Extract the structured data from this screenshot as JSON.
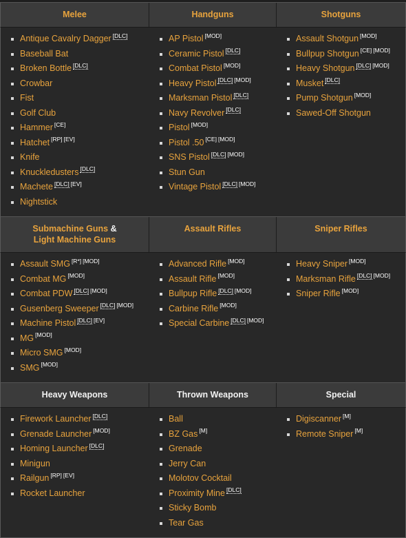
{
  "theme": {
    "page_background": "#1e1e1e",
    "table_background": "#282828",
    "header_background": "#3b3b3b",
    "link_color": "#e8a33d",
    "tag_color": "#ffffff",
    "border_color": "#5a5a5a"
  },
  "sections": [
    {
      "headers": [
        {
          "label": "Melee",
          "style": "gold"
        },
        {
          "label": "Handguns",
          "style": "gold"
        },
        {
          "label": "Shotguns",
          "style": "gold"
        }
      ],
      "columns": [
        [
          {
            "name": "Antique Cavalry Dagger",
            "tags": [
              "DLC"
            ]
          },
          {
            "name": "Baseball Bat",
            "tags": []
          },
          {
            "name": "Broken Bottle",
            "tags": [
              "DLC"
            ]
          },
          {
            "name": "Crowbar",
            "tags": []
          },
          {
            "name": "Fist",
            "tags": []
          },
          {
            "name": "Golf Club",
            "tags": []
          },
          {
            "name": "Hammer",
            "tags": [
              "CE"
            ]
          },
          {
            "name": "Hatchet",
            "tags": [
              "RP",
              "EV"
            ]
          },
          {
            "name": "Knife",
            "tags": []
          },
          {
            "name": "Knuckledusters",
            "tags": [
              "DLC"
            ]
          },
          {
            "name": "Machete",
            "tags": [
              "DLC",
              "EV"
            ]
          },
          {
            "name": "Nightstick",
            "tags": []
          }
        ],
        [
          {
            "name": "AP Pistol",
            "tags": [
              "MOD"
            ]
          },
          {
            "name": "Ceramic Pistol",
            "tags": [
              "DLC"
            ]
          },
          {
            "name": "Combat Pistol",
            "tags": [
              "MOD"
            ]
          },
          {
            "name": "Heavy Pistol",
            "tags": [
              "DLC",
              "MOD"
            ]
          },
          {
            "name": "Marksman Pistol",
            "tags": [
              "DLC"
            ]
          },
          {
            "name": "Navy Revolver",
            "tags": [
              "DLC"
            ]
          },
          {
            "name": "Pistol",
            "tags": [
              "MOD"
            ]
          },
          {
            "name": "Pistol .50",
            "tags": [
              "CE",
              "MOD"
            ]
          },
          {
            "name": "SNS Pistol",
            "tags": [
              "DLC",
              "MOD"
            ]
          },
          {
            "name": "Stun Gun",
            "tags": []
          },
          {
            "name": "Vintage Pistol",
            "tags": [
              "DLC",
              "MOD"
            ]
          }
        ],
        [
          {
            "name": "Assault Shotgun",
            "tags": [
              "MOD"
            ]
          },
          {
            "name": "Bullpup Shotgun",
            "tags": [
              "CE",
              "MOD"
            ]
          },
          {
            "name": "Heavy Shotgun",
            "tags": [
              "DLC",
              "MOD"
            ]
          },
          {
            "name": "Musket",
            "tags": [
              "DLC"
            ]
          },
          {
            "name": "Pump Shotgun",
            "tags": [
              "MOD"
            ]
          },
          {
            "name": "Sawed-Off Shotgun",
            "tags": []
          }
        ]
      ]
    },
    {
      "headers": [
        {
          "label": "Submachine Guns & Light Machine Guns",
          "style": "gold",
          "two_line": true,
          "line1": "Submachine Guns",
          "amp": "&",
          "line2": "Light Machine Guns"
        },
        {
          "label": "Assault Rifles",
          "style": "gold"
        },
        {
          "label": "Sniper Rifles",
          "style": "gold"
        }
      ],
      "columns": [
        [
          {
            "name": "Assault SMG",
            "tags": [
              "R*",
              "MOD"
            ]
          },
          {
            "name": "Combat MG",
            "tags": [
              "MOD"
            ]
          },
          {
            "name": "Combat PDW",
            "tags": [
              "DLC",
              "MOD"
            ]
          },
          {
            "name": "Gusenberg Sweeper",
            "tags": [
              "DLC",
              "MOD"
            ]
          },
          {
            "name": "Machine Pistol",
            "tags": [
              "DLC",
              "EV"
            ]
          },
          {
            "name": "MG",
            "tags": [
              "MOD"
            ]
          },
          {
            "name": "Micro SMG",
            "tags": [
              "MOD"
            ]
          },
          {
            "name": "SMG",
            "tags": [
              "MOD"
            ]
          }
        ],
        [
          {
            "name": "Advanced Rifle",
            "tags": [
              "MOD"
            ]
          },
          {
            "name": "Assault Rifle",
            "tags": [
              "MOD"
            ]
          },
          {
            "name": "Bullpup Rifle",
            "tags": [
              "DLC",
              "MOD"
            ]
          },
          {
            "name": "Carbine Rifle",
            "tags": [
              "MOD"
            ]
          },
          {
            "name": "Special Carbine",
            "tags": [
              "DLC",
              "MOD"
            ]
          }
        ],
        [
          {
            "name": "Heavy Sniper",
            "tags": [
              "MOD"
            ]
          },
          {
            "name": "Marksman Rifle",
            "tags": [
              "DLC",
              "MOD"
            ]
          },
          {
            "name": "Sniper Rifle",
            "tags": [
              "MOD"
            ]
          }
        ]
      ]
    },
    {
      "headers": [
        {
          "label": "Heavy Weapons",
          "style": "white"
        },
        {
          "label": "Thrown Weapons",
          "style": "white"
        },
        {
          "label": "Special",
          "style": "white"
        }
      ],
      "columns": [
        [
          {
            "name": "Firework Launcher",
            "tags": [
              "DLC"
            ]
          },
          {
            "name": "Grenade Launcher",
            "tags": [
              "MOD"
            ]
          },
          {
            "name": "Homing Launcher",
            "tags": [
              "DLC"
            ]
          },
          {
            "name": "Minigun",
            "tags": []
          },
          {
            "name": "Railgun",
            "tags": [
              "RP",
              "EV"
            ]
          },
          {
            "name": "Rocket Launcher",
            "tags": []
          }
        ],
        [
          {
            "name": "Ball",
            "tags": []
          },
          {
            "name": "BZ Gas",
            "tags": [
              "M"
            ]
          },
          {
            "name": "Grenade",
            "tags": []
          },
          {
            "name": "Jerry Can",
            "tags": []
          },
          {
            "name": "Molotov Cocktail",
            "tags": []
          },
          {
            "name": "Proximity Mine",
            "tags": [
              "DLC"
            ]
          },
          {
            "name": "Sticky Bomb",
            "tags": []
          },
          {
            "name": "Tear Gas",
            "tags": []
          }
        ],
        [
          {
            "name": "Digiscanner",
            "tags": [
              "M"
            ]
          },
          {
            "name": "Remote Sniper",
            "tags": [
              "M"
            ]
          }
        ]
      ]
    }
  ]
}
